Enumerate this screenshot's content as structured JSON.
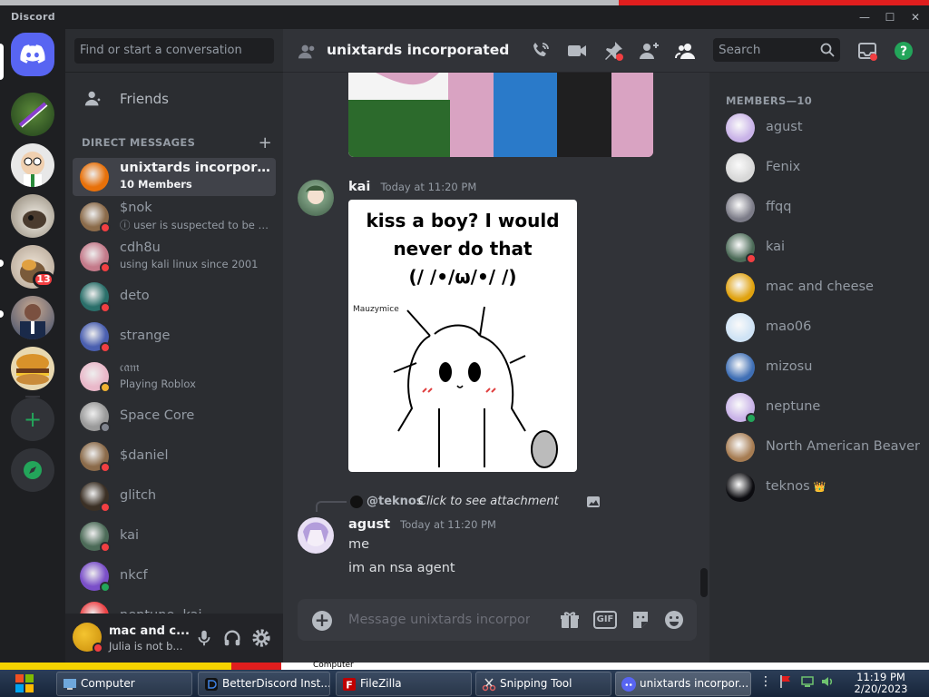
{
  "app": {
    "title": "Discord"
  },
  "window_controls": {
    "minimize": "—",
    "maximize": "☐",
    "close": "✕"
  },
  "rail": {
    "unread_badge": "13"
  },
  "dm_sidebar": {
    "search_placeholder": "Find or start a conversation",
    "friends_label": "Friends",
    "direct_messages_label": "DIRECT MESSAGES",
    "add_dm": "+",
    "items": [
      {
        "name": "unixtards incorporated",
        "sub": "10 Members",
        "status": "",
        "color": "#e8710a",
        "active": true
      },
      {
        "name": "$nok",
        "sub": "ⓘ user is suspected to be a p...",
        "status": "dnd",
        "color": "#8b6b4a"
      },
      {
        "name": "cdh8u",
        "sub": "using kali linux since 2001",
        "status": "dnd",
        "color": "#c47a8a"
      },
      {
        "name": "deto",
        "sub": "",
        "status": "dnd",
        "color": "#2a6f6a"
      },
      {
        "name": "strange",
        "sub": "",
        "status": "dnd",
        "color": "#4a5fb0"
      },
      {
        "name": "𝔠𝔞𝔪",
        "sub": "Playing Roblox",
        "status": "idle",
        "color": "#e9b8c9"
      },
      {
        "name": "Space Core",
        "sub": "",
        "status": "offline",
        "color": "#9a9a9a"
      },
      {
        "name": "$daniel",
        "sub": "",
        "status": "dnd",
        "color": "#8b6b4a"
      },
      {
        "name": "glitch",
        "sub": "",
        "status": "dnd",
        "color": "#3b3025"
      },
      {
        "name": "kai",
        "sub": "",
        "status": "dnd",
        "color": "#4c6b58"
      },
      {
        "name": "nkcf",
        "sub": "",
        "status": "online",
        "color": "#7a4fc9"
      },
      {
        "name": "neptune, kai",
        "sub": "",
        "status": "",
        "color": "#ed4245"
      }
    ]
  },
  "user_panel": {
    "name": "mac and c...",
    "status": "Julia is not b..."
  },
  "chat": {
    "title": "unixtards incorporated",
    "search_placeholder": "Search",
    "messages": [
      {
        "author": "kai",
        "time": "Today at 11:20 PM",
        "meme_caption": "kiss a boy? I would never do that (/ /•/ω/•/ /)",
        "meme_credit": "Mauzymice"
      },
      {
        "reply_to": "@teknos",
        "reply_text": "Click to see attachment",
        "author": "agust",
        "time": "Today at 11:20 PM",
        "lines": [
          "me",
          "im an nsa agent"
        ]
      }
    ],
    "composer_placeholder": "Message unixtards incorpor...",
    "gif_label": "GIF"
  },
  "members": {
    "header": "MEMBERS—10",
    "items": [
      {
        "name": "agust",
        "status": "",
        "color": "#c9b3e8"
      },
      {
        "name": "Fenix",
        "status": "",
        "color": "#d8d8d8"
      },
      {
        "name": "ffqq",
        "status": "",
        "color": "#7c7c88"
      },
      {
        "name": "kai",
        "status": "dnd",
        "color": "#4c6b58"
      },
      {
        "name": "mac and cheese",
        "status": "",
        "color": "#e0a20f"
      },
      {
        "name": "mao06",
        "status": "",
        "color": "#cfe3f5"
      },
      {
        "name": "mizosu",
        "status": "",
        "color": "#3f6fb5"
      },
      {
        "name": "neptune",
        "status": "online",
        "color": "#c9b3e8"
      },
      {
        "name": "North American Beaver",
        "status": "",
        "color": "#a67c52"
      },
      {
        "name": "teknos",
        "status": "",
        "color": "#0c0c10",
        "crown": "👑"
      }
    ]
  },
  "taskbar": {
    "items": [
      {
        "label": "Computer"
      },
      {
        "label": "BetterDiscord Inst..."
      },
      {
        "label": "FileZilla"
      },
      {
        "label": "Snipping Tool"
      },
      {
        "label": "unixtards incorpor..."
      }
    ],
    "time": "11:19 PM",
    "date": "2/20/2023"
  },
  "behind_window": {
    "label": "Computer"
  },
  "colors": {
    "accent": "#5865f2",
    "dnd": "#f23f42",
    "online": "#23a55a",
    "idle": "#f0b232"
  }
}
